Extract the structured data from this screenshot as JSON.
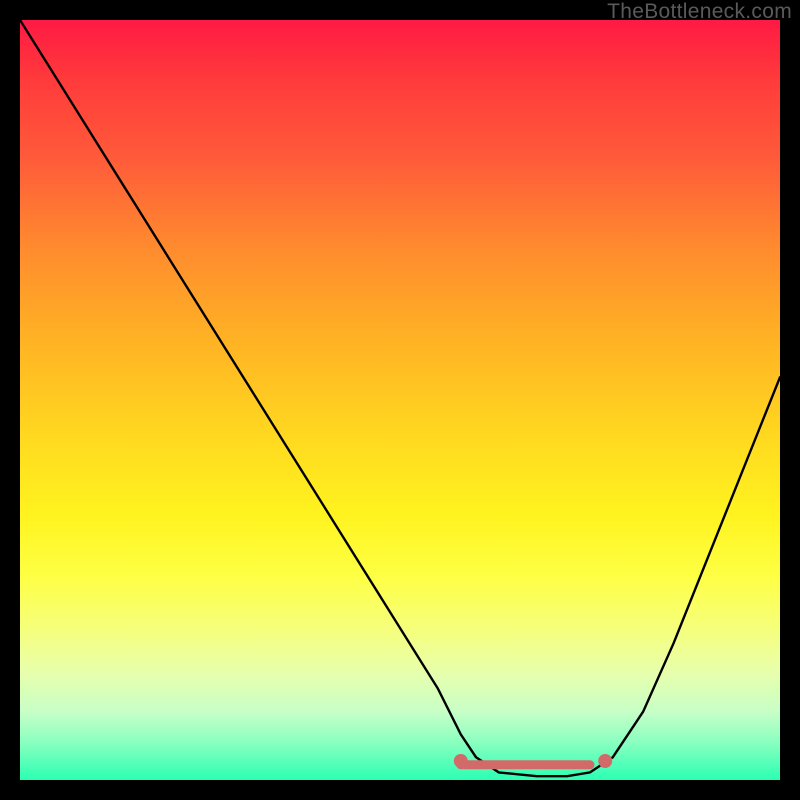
{
  "watermark": "TheBottleneck.com",
  "chart_data": {
    "type": "line",
    "title": "",
    "xlabel": "",
    "ylabel": "",
    "xlim": [
      0,
      100
    ],
    "ylim": [
      0,
      100
    ],
    "series": [
      {
        "name": "bottleneck-curve",
        "color": "#000000",
        "x": [
          0,
          5,
          10,
          15,
          20,
          25,
          30,
          35,
          40,
          45,
          50,
          55,
          58,
          60,
          63,
          68,
          72,
          75,
          78,
          82,
          86,
          90,
          94,
          98,
          100
        ],
        "values": [
          100,
          92,
          84,
          76,
          68,
          60,
          52,
          44,
          36,
          28,
          20,
          12,
          6,
          3,
          1,
          0.5,
          0.5,
          1,
          3,
          9,
          18,
          28,
          38,
          48,
          53
        ]
      }
    ],
    "markers": [
      {
        "name": "flat-left-dot",
        "x": 58,
        "y": 2.5,
        "color": "#d36a6a"
      },
      {
        "name": "flat-right-dot",
        "x": 77,
        "y": 2.5,
        "color": "#d36a6a"
      }
    ],
    "flat_segment": {
      "x0": 58,
      "x1": 75,
      "y": 2.0,
      "color": "#d36a6a"
    },
    "gradient_stops": [
      {
        "pos": 0,
        "color": "#ff1a44"
      },
      {
        "pos": 8,
        "color": "#ff3b3b"
      },
      {
        "pos": 18,
        "color": "#ff5a3a"
      },
      {
        "pos": 30,
        "color": "#ff8b2e"
      },
      {
        "pos": 42,
        "color": "#ffb224"
      },
      {
        "pos": 55,
        "color": "#ffd91f"
      },
      {
        "pos": 65,
        "color": "#fff31f"
      },
      {
        "pos": 73,
        "color": "#feff43"
      },
      {
        "pos": 80,
        "color": "#f6ff7a"
      },
      {
        "pos": 86,
        "color": "#e7ffad"
      },
      {
        "pos": 91,
        "color": "#c7ffc7"
      },
      {
        "pos": 95,
        "color": "#8affc0"
      },
      {
        "pos": 100,
        "color": "#2bffb3"
      }
    ]
  }
}
